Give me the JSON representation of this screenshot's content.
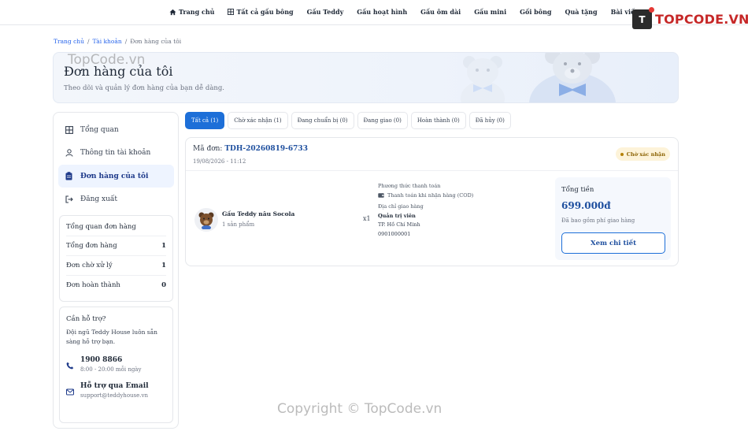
{
  "nav": {
    "items": [
      "Trang chủ",
      "Tất cả gấu bông",
      "Gấu Teddy",
      "Gấu hoạt hình",
      "Gấu ôm dài",
      "Gấu mini",
      "Gối bông",
      "Quà tặng",
      "Bài viết"
    ],
    "icons": [
      "home-icon",
      "grid-icon"
    ]
  },
  "logo": {
    "mark": "T",
    "text": "TOPCODE.VN"
  },
  "breadcrumb": {
    "home": "Trang chủ",
    "account": "Tài khoản",
    "current": "Đơn hàng của tôi",
    "sep": "/"
  },
  "hero": {
    "title": "Đơn hàng của tôi",
    "subtitle": "Theo dõi và quản lý đơn hàng của bạn dễ dàng."
  },
  "sidebar": {
    "items": [
      {
        "label": "Tổng quan",
        "icon": "grid-icon"
      },
      {
        "label": "Thông tin tài khoản",
        "icon": "user-icon"
      },
      {
        "label": "Đơn hàng của tôi",
        "icon": "clipboard-icon"
      },
      {
        "label": "Đăng xuất",
        "icon": "logout-icon"
      }
    ],
    "stats": {
      "title": "Tổng quan đơn hàng",
      "rows": [
        {
          "label": "Tổng đơn hàng",
          "value": "1"
        },
        {
          "label": "Đơn chờ xử lý",
          "value": "1"
        },
        {
          "label": "Đơn hoàn thành",
          "value": "0"
        }
      ]
    },
    "support": {
      "title": "Cần hỗ trợ?",
      "desc": "Đội ngũ Teddy House luôn sẵn sàng hỗ trợ bạn.",
      "phone": "1900 8866",
      "hours": "8:00 - 20:00 mỗi ngày",
      "email_title": "Hỗ trợ qua Email",
      "email": "support@teddyhouse.vn"
    }
  },
  "tabs": [
    "Tất cả (1)",
    "Chờ xác nhận (1)",
    "Đang chuẩn bị (0)",
    "Đang giao (0)",
    "Hoàn thành (0)",
    "Đã hủy (0)"
  ],
  "order": {
    "code_label": "Mã đơn:",
    "code": "TDH-20260819-6733",
    "date": "19/08/2026 - 11:12",
    "status": "Chờ xác nhận",
    "product": {
      "name": "Gấu Teddy nâu Socola",
      "count": "1 sản phẩm",
      "qty": "x1"
    },
    "payment_label": "Phương thức thanh toán",
    "payment_method": "Thanh toán khi nhận hàng (COD)",
    "address_label": "Địa chỉ giao hàng",
    "receiver": "Quản trị viên",
    "city": "TP. Hồ Chí Minh",
    "phone": "0901000001",
    "total_label": "Tổng tiền",
    "total": "699.000đ",
    "total_note": "Đã bao gồm phí giao hàng",
    "detail_button": "Xem chi tiết"
  },
  "watermark": "TopCode.vn",
  "copyright": "Copyright © TopCode.vn"
}
